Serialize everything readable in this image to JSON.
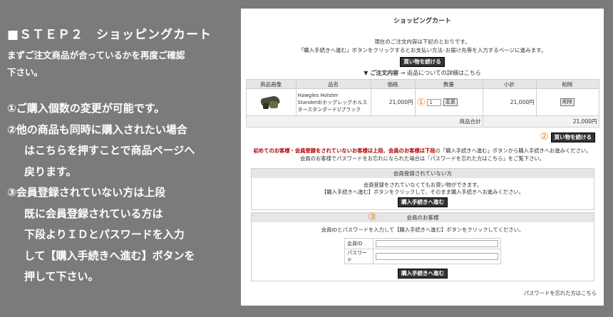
{
  "left": {
    "title": "■ＳＴＥＰ２　ショッピングカート",
    "intro_lines": [
      "まずご注文商品が合っているかを再度ご確認",
      "下さい。"
    ],
    "steps": [
      "①ご購入個数の変更が可能です。",
      "②他の商品も同時に購入されたい場合",
      "はこちらを押すことで商品ページへ",
      "戻ります。",
      "③会員登録されていない方は上段",
      "既に会員登録されている方は",
      "下段よりＩＤとパスワードを入力",
      "して【購入手続きへ進む】ボタンを",
      "押して下さい。"
    ]
  },
  "page": {
    "title": "ショッピングカート",
    "msg1": "現在のご注文内容は下記のとおりです。",
    "msg2": "「購入手続きへ進む」ボタンをクリックするとお支払い方法･お届け先等を入力するページに進みます。",
    "continue_btn": "買い物を続ける",
    "order_label": "▼ ご注文内容",
    "order_link": "→ 返品についての詳細はこちら",
    "table": {
      "headers": [
        "商品画像",
        "品名",
        "価格",
        "数量",
        "小計",
        "削除"
      ],
      "row": {
        "name": "Hawgles Holster Standerd(ホッグレッグホルスタースタンダード)/ブラック",
        "price": "21,000円",
        "qty_marker": "①",
        "qty": "1",
        "change_btn": "変更",
        "subtotal": "21,000円",
        "delete_btn": "削除"
      },
      "total_label": "商品合計",
      "total_value": "21,000円"
    },
    "marker2": "②",
    "notice_red": "初めてのお客様・会員登録をされていないお客様は上段、会員のお客様は下段",
    "notice_rest": "の「購入手続きへ進む」ボタンから購入手続きへお進みください。",
    "notice2": "会員のお客様でパスワードをお忘れになられた場合は「パスワードを忘れた方はこちら」をご覧下さい。",
    "marker3": "③",
    "guest": {
      "header": "会員登録されていない方",
      "line1": "会員登録をされていなくてもお買い物ができます。",
      "line2": "【購入手続きへ進む】ボタンをクリックして、そのまま購入手続きへお進みください。",
      "button": "購入手続きへ進む"
    },
    "member": {
      "header": "会員のお客様",
      "line1": "会員IDとパスワードを入力して【購入手続きへ進む】ボタンをクリックしてください。",
      "id_label": "会員ID",
      "pw_label": "パスワード",
      "button": "購入手続きへ進む"
    },
    "forgot": "パスワードを忘れた方はこちら"
  }
}
